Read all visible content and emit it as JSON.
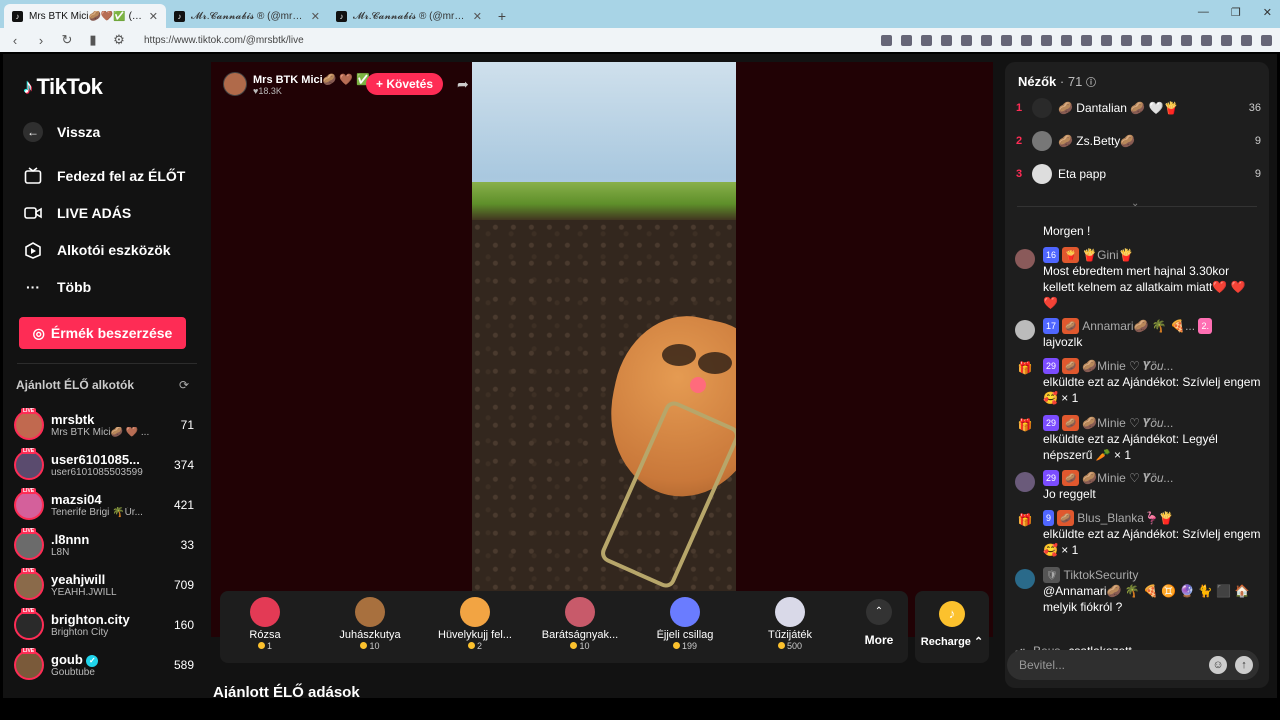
{
  "browser": {
    "tabs": [
      {
        "title": "Mrs BTK Mici🥔🤎✅ (@m",
        "active": true
      },
      {
        "title": "𝓜𝓻.𝓒𝓪𝓷𝓷𝓪𝓫𝓲𝓼 ® (@mrcannabis_)",
        "active": false
      },
      {
        "title": "𝓜𝓻.𝓒𝓪𝓷𝓷𝓪𝓫𝓲𝓼 ® (@mrcannabis_)",
        "active": false
      }
    ],
    "url": "https://www.tiktok.com/@mrsbtk/live"
  },
  "sidebar": {
    "logo": "TikTok",
    "nav": [
      {
        "label": "Vissza",
        "icon": "arrow-left-icon"
      },
      {
        "label": "Fedezd fel az ÉLŐT",
        "icon": "tv-icon"
      },
      {
        "label": "LIVE ADÁS",
        "icon": "video-camera-icon"
      },
      {
        "label": "Alkotói eszközök",
        "icon": "creator-tools-icon"
      },
      {
        "label": "Több",
        "icon": "more-dots-icon"
      }
    ],
    "coins_button": "Érmék beszerzése",
    "recommended_title": "Ajánlott ÉLŐ alkotók",
    "live_badge": "LIVE",
    "creators": [
      {
        "name": "mrsbtk",
        "sub": "Mrs BTK Mici🥔 🤎 ...",
        "count": "71",
        "color": "#c1694f"
      },
      {
        "name": "user6101085...",
        "sub": "user6101085503599",
        "count": "374",
        "color": "#5a4b6e"
      },
      {
        "name": "mazsi04",
        "sub": "Tenerife Brigi 🌴Úr...",
        "count": "421",
        "color": "#d4609b"
      },
      {
        "name": ".l8nnn",
        "sub": "L8N",
        "count": "33",
        "color": "#6b6b6b"
      },
      {
        "name": "yeahjwill",
        "sub": "YEAHH.JWILL",
        "count": "709",
        "color": "#8a6a4a"
      },
      {
        "name": "brighton.city",
        "sub": "Brighton City",
        "count": "160",
        "color": "#2a2a2a"
      },
      {
        "name": "goub",
        "sub": "Goubtube",
        "count": "589",
        "color": "#7a5a3a"
      }
    ]
  },
  "stream": {
    "host_name": "Mrs BTK Mici🥔 🤎 ✅",
    "host_likes": "♥18.3K",
    "follow_label": "+ Követés"
  },
  "gifts": [
    {
      "name": "Rózsa",
      "price": "1",
      "color": "#e33a55"
    },
    {
      "name": "Juhászkutya",
      "price": "10",
      "color": "#a8703e"
    },
    {
      "name": "Hüvelykujj fel...",
      "price": "2",
      "color": "#f2a443"
    },
    {
      "name": "Barátságnyak...",
      "price": "10",
      "color": "#c85a6a"
    },
    {
      "name": "Éjjeli csillag",
      "price": "199",
      "color": "#6a7cff"
    },
    {
      "name": "Tűzijáték",
      "price": "500",
      "color": "#d9d9e8"
    }
  ],
  "more_label": "More",
  "recharge_label": "Recharge ⌃",
  "recommended_live_title": "Ajánlott ÉLŐ adások",
  "chat": {
    "viewers_label": "Nézők",
    "viewers_count": "· 71",
    "top_viewers": [
      {
        "rank": "1",
        "name": "🥔 Dantalian 🥔 🤍🍟",
        "score": "36"
      },
      {
        "rank": "2",
        "name": "🥔 Zs.Betty🥔",
        "score": "9"
      },
      {
        "rank": "3",
        "name": "Eta papp",
        "score": "9"
      }
    ],
    "messages": [
      {
        "type": "comment",
        "badges": [],
        "user": "",
        "text": "Morgen !"
      },
      {
        "type": "comment",
        "badges": [
          "16",
          "🍟"
        ],
        "user": "🍟Gini🍟",
        "text": "Most ébredtem mert hajnal 3.30kor kellett kelnem az allatkaim miatt❤️ ❤️ ❤️"
      },
      {
        "type": "comment",
        "badges": [
          "17",
          "🥔"
        ],
        "user": "Annamari🥔 🌴 🍕...",
        "extra": "2.",
        "text": "lajvozlk"
      },
      {
        "type": "gift",
        "badges": [
          "29",
          "🥔"
        ],
        "user": "🥔Minie ♡ 𝒀̈𝑜̈𝑢...",
        "text": "elküldte ezt az Ajándékot: Szívlelj engem 🥰 × 1"
      },
      {
        "type": "gift",
        "badges": [
          "29",
          "🥔"
        ],
        "user": "🥔Minie ♡ 𝒀̈𝑜̈𝑢...",
        "text": "elküldte ezt az Ajándékot: Legyél népszerű 🥕 × 1"
      },
      {
        "type": "comment",
        "badges": [
          "29",
          "🥔"
        ],
        "user": "🥔Minie ♡ 𝒀̈𝑜̈𝑢...",
        "text": "Jo reggelt"
      },
      {
        "type": "gift",
        "badges": [
          "9",
          "🥔"
        ],
        "user": "Blus_Blanka🦩🍟",
        "text": "elküldte ezt az Ajándékot: Szívlelj engem 🥰 × 1"
      },
      {
        "type": "comment",
        "badges": [
          "🛡"
        ],
        "user": "TiktokSecurity",
        "text": "@Annamari🥔 🌴 🍕 ♊ 🔮 🐈 ⬛ 🏠 melyik fiókról ?"
      }
    ],
    "join_user": "Beus",
    "join_text": "csatlakozott",
    "input_placeholder": "Bevitel..."
  }
}
